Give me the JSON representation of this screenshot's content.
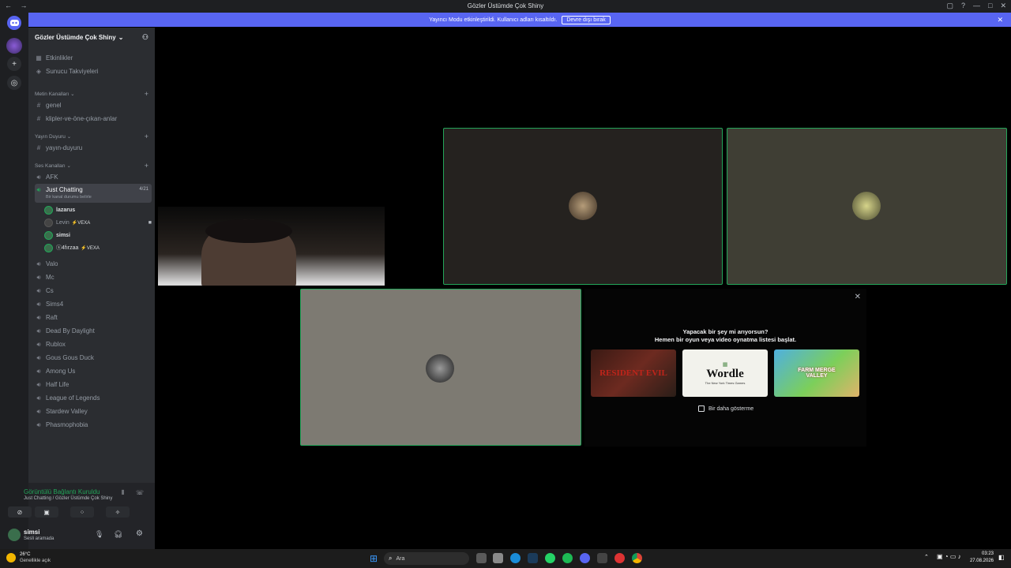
{
  "titlebar": {
    "title": "Gözler Üstümde Çok Shiny",
    "nav": "← →",
    "controls": [
      "▢",
      "?",
      "—",
      "□",
      "✕"
    ]
  },
  "notice": {
    "text": "Yayıncı Modu etkinleştirildi. Kullanıcı adları kısaltıldı.",
    "button": "Devre dışı bırak",
    "close": "✕"
  },
  "server": {
    "name": "Gözler Üstümde Çok Shiny",
    "chevron": "⌄",
    "invite_icon": "person-add-icon"
  },
  "sidebar": {
    "top_items": [
      {
        "label": "Etkinlikler",
        "icon": "calendar-icon"
      },
      {
        "label": "Sunucu Takviyeleri",
        "icon": "boost-icon"
      }
    ],
    "text_category": "Metin Kanalları",
    "text_channels": [
      "genel",
      "klipler-ve-öne-çıkan-anlar"
    ],
    "announce_category": "Yayın Duyuru",
    "announce_channels": [
      "yayın-duyuru"
    ],
    "voice_category": "Ses Kanalları",
    "voice_afk": "AFK",
    "active_channel": {
      "name": "Just Chatting",
      "count": "4/21",
      "status": "Bir kanal durumu belirle"
    },
    "voice_users": [
      {
        "name": "lazarus",
        "tag": ""
      },
      {
        "name": "Levin",
        "tag": "VEXA"
      },
      {
        "name": "simsi",
        "tag": ""
      },
      {
        "name": "ⓢ4fırzaa",
        "tag": "VEXA"
      }
    ],
    "voice_channels": [
      "Valo",
      "Mc",
      "Cs",
      "Sims4",
      "Raft",
      "Dead By Daylight",
      "Rublox",
      "Gous Gous Duck",
      "Among Us",
      "Half Life",
      "League of Legends",
      "Stardew Valley",
      "Phasmophobia"
    ]
  },
  "voice_panel": {
    "status": "Görüntülü Bağlantı Kuruldu",
    "location": "Just Chatting / Gözler Üstümde Çok Shiny",
    "username": "simsi",
    "user_status": "Sesli aramada"
  },
  "activity": {
    "title": "Yapacak bir şey mi arıyorsun?",
    "subtitle": "Hemen bir oyun veya video oynatma listesi başlat.",
    "games": [
      "RESIDENT EVIL",
      "Wordle",
      "FARM MERGE VALLEY"
    ],
    "wordle_sub": "The New York Times Games",
    "dont_show": "Bir daha gösterme",
    "close": "✕"
  },
  "taskbar": {
    "weather_temp": "26°C",
    "weather_text": "Genellikle açık",
    "search": "Ara",
    "time": "03:23",
    "date": "27.08.2026"
  },
  "colors": {
    "accent": "#5865f2",
    "speaking": "#23a559",
    "sidebar": "#2b2d31"
  }
}
